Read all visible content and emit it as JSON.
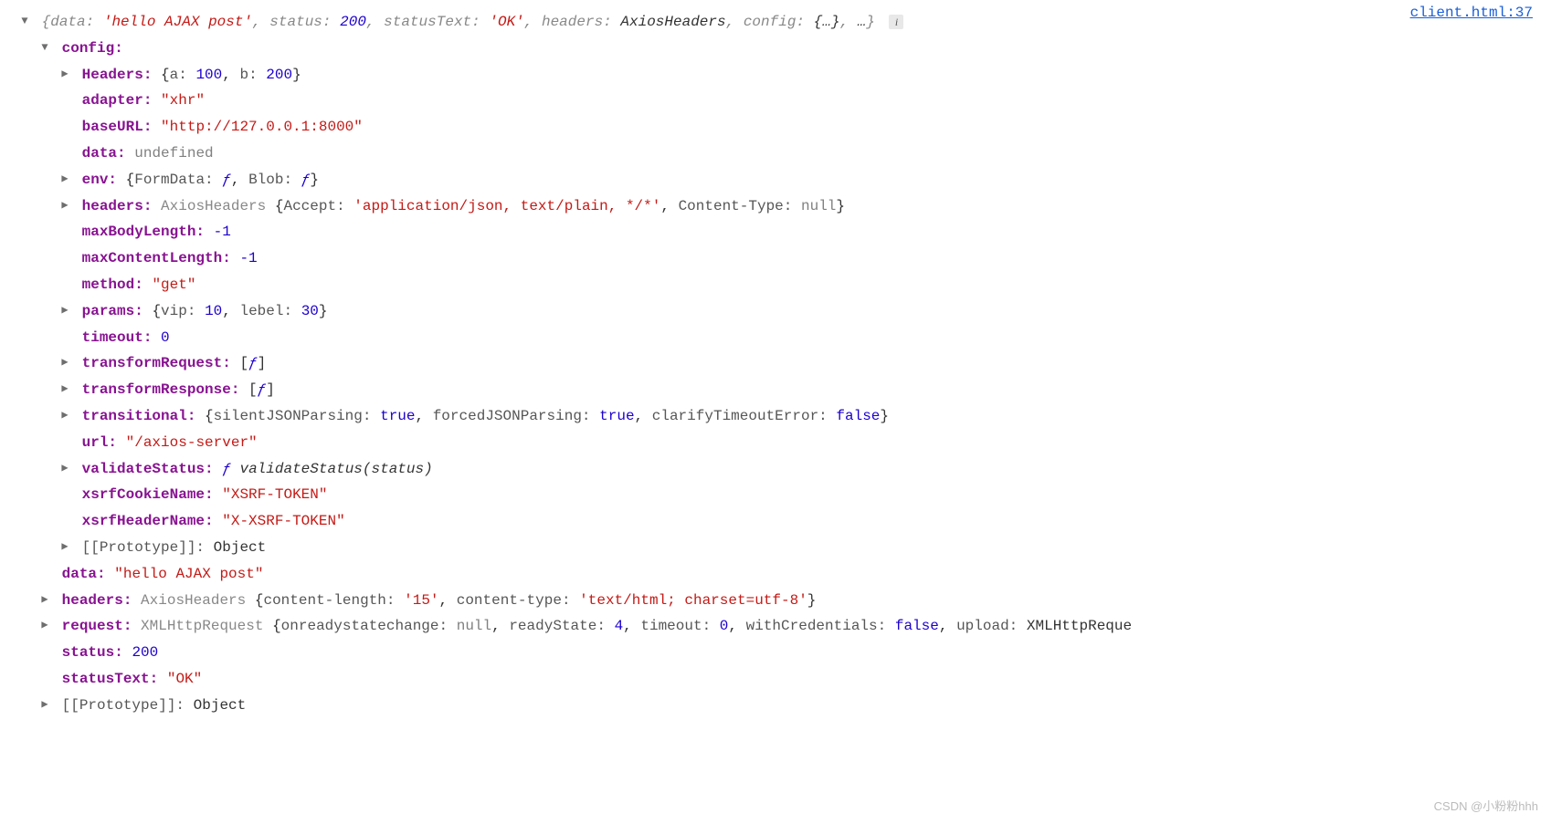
{
  "topLink": "client.html:37",
  "root": {
    "summary": {
      "data_key": "data:",
      "data_val": "'hello AJAX post'",
      "status_key": "status:",
      "status_val": "200",
      "statusText_key": "statusText:",
      "statusText_val": "'OK'",
      "headers_key": "headers:",
      "headers_val": "AxiosHeaders",
      "config_key": "config:",
      "config_val": "{…}",
      "ellipsis": "…"
    }
  },
  "config": {
    "label": "config:",
    "headers_u": {
      "key": "Headers:",
      "val": "{a: 100, b: 200}",
      "a_key": "a:",
      "a_val": "100",
      "b_key": "b:",
      "b_val": "200"
    },
    "adapter": {
      "key": "adapter:",
      "val": "\"xhr\""
    },
    "baseURL": {
      "key": "baseURL:",
      "val": "\"http://127.0.0.1:8000\""
    },
    "data": {
      "key": "data:",
      "val": "undefined"
    },
    "env": {
      "key": "env:",
      "form_key": "FormData:",
      "blob_key": "Blob:",
      "fn": "ƒ"
    },
    "headers_l": {
      "key": "headers:",
      "ctor": "AxiosHeaders",
      "accept_key": "Accept:",
      "accept_val": "'application/json, text/plain, */*'",
      "ct_key": "Content-Type:",
      "ct_val": "null"
    },
    "maxBodyLength": {
      "key": "maxBodyLength:",
      "val": "-1"
    },
    "maxContentLength": {
      "key": "maxContentLength:",
      "val": "-1"
    },
    "method": {
      "key": "method:",
      "val": "\"get\""
    },
    "params": {
      "key": "params:",
      "vip_key": "vip:",
      "vip_val": "10",
      "lebel_key": "lebel:",
      "lebel_val": "30"
    },
    "timeout": {
      "key": "timeout:",
      "val": "0"
    },
    "transformRequest": {
      "key": "transformRequest:",
      "fn": "ƒ"
    },
    "transformResponse": {
      "key": "transformResponse:",
      "fn": "ƒ"
    },
    "transitional": {
      "key": "transitional:",
      "s_key": "silentJSONParsing:",
      "s_val": "true",
      "f_key": "forcedJSONParsing:",
      "f_val": "true",
      "c_key": "clarifyTimeoutError:",
      "c_val": "false"
    },
    "url": {
      "key": "url:",
      "val": "\"/axios-server\""
    },
    "validateStatus": {
      "key": "validateStatus:",
      "fn": "ƒ",
      "sig": "validateStatus(status)"
    },
    "xsrfCookieName": {
      "key": "xsrfCookieName:",
      "val": "\"XSRF-TOKEN\""
    },
    "xsrfHeaderName": {
      "key": "xsrfHeaderName:",
      "val": "\"X-XSRF-TOKEN\""
    },
    "proto": {
      "key": "[[Prototype]]:",
      "val": "Object"
    }
  },
  "data_out": {
    "key": "data:",
    "val": "\"hello AJAX post\""
  },
  "headers_out": {
    "key": "headers:",
    "ctor": "AxiosHeaders",
    "cl_key": "content-length:",
    "cl_val": "'15'",
    "ct_key": "content-type:",
    "ct_val": "'text/html; charset=utf-8'"
  },
  "request_out": {
    "key": "request:",
    "ctor": "XMLHttpRequest",
    "orsc_key": "onreadystatechange:",
    "orsc_val": "null",
    "rs_key": "readyState:",
    "rs_val": "4",
    "to_key": "timeout:",
    "to_val": "0",
    "wc_key": "withCredentials:",
    "wc_val": "false",
    "up_key": "upload:",
    "up_val": "XMLHttpReque"
  },
  "status_out": {
    "key": "status:",
    "val": "200"
  },
  "statusText_out": {
    "key": "statusText:",
    "val": "\"OK\""
  },
  "proto_out": {
    "key": "[[Prototype]]:",
    "val": "Object"
  },
  "watermark": "CSDN @小粉粉hhh",
  "info_char": "i"
}
